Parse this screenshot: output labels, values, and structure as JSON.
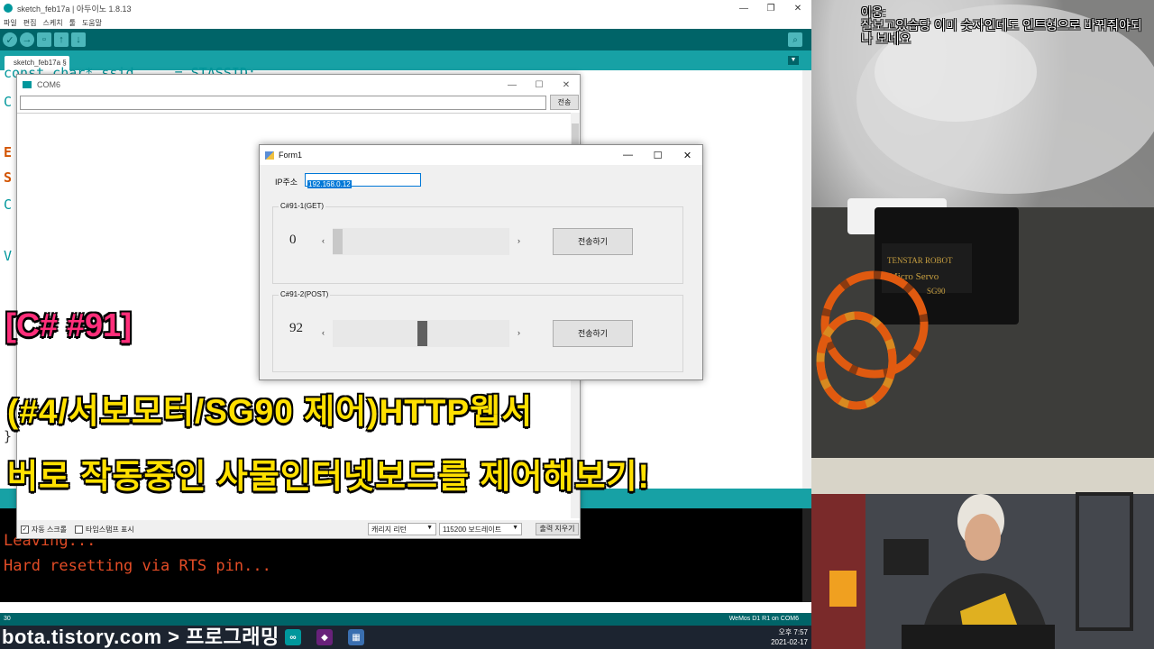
{
  "ide": {
    "window_title": "sketch_feb17a | 아두이노 1.8.13",
    "menu": [
      "파일",
      "편집",
      "스케치",
      "툴",
      "도움말"
    ],
    "tab_label": "sketch_feb17a §",
    "code_fragments": [
      {
        "text": "const char* ssid     = STASSID;",
        "color": "#00979c"
      },
      {
        "text": "C",
        "color": "#00979c"
      },
      {
        "text": "E",
        "color": "#d35400"
      },
      {
        "text": "S",
        "color": "#d35400"
      },
      {
        "text": "C",
        "color": "#00979c"
      },
      {
        "text": "V",
        "color": "#00979c"
      },
      {
        "text": "}",
        "color": "#333333"
      }
    ],
    "console_lines": [
      "Leaving...",
      "Hard resetting via RTS pin..."
    ],
    "status_line": "30",
    "status_board": "WeMos D1 R1 on COM6",
    "colors": {
      "teal_dark": "#006468",
      "teal_light": "#17a1a5",
      "console_text": "#e34c26"
    }
  },
  "com6": {
    "title": "COM6",
    "send_label": "전송",
    "autoscroll_label": "자동 스크롤",
    "autoscroll_checked": true,
    "timestamp_label": "타임스탬프 표시",
    "timestamp_checked": false,
    "line_ending": "캐리지 리턴",
    "baud": "115200 보드레이트",
    "clear_label": "출력 지우기"
  },
  "form1": {
    "title": "Form1",
    "ip_label": "IP주소",
    "ip_value": "192.168.0.12",
    "get_group": {
      "label": "C#91-1(GET)",
      "value": "0",
      "slider_fraction": 0.0,
      "send_label": "전송하기"
    },
    "post_group": {
      "label": "C#91-2(POST)",
      "value": "92",
      "slider_fraction": 0.51,
      "send_label": "전송하기"
    }
  },
  "caption": {
    "line1": "[C# #91]",
    "line2": "(#4/서보모터/SG90 제어)HTTP웹서",
    "line3": "버로 작동중인 사물인터넷보드를 제어해보기!",
    "colors": {
      "line1": "#ff2e7a",
      "main": "#ffe000"
    }
  },
  "chat": {
    "user": "이웅:",
    "message": "잘보고있습당 이미 숫자인데도 인트형으로 바꿔줘야되나 보네요"
  },
  "servo_labels": [
    "TENSTAR ROBOT",
    "Micro Servo",
    "SG90"
  ],
  "taskbar": {
    "watermark": "bota.tistory.com > 프로그래밍",
    "time": "오후 7:57",
    "date": "2021-02-17"
  }
}
